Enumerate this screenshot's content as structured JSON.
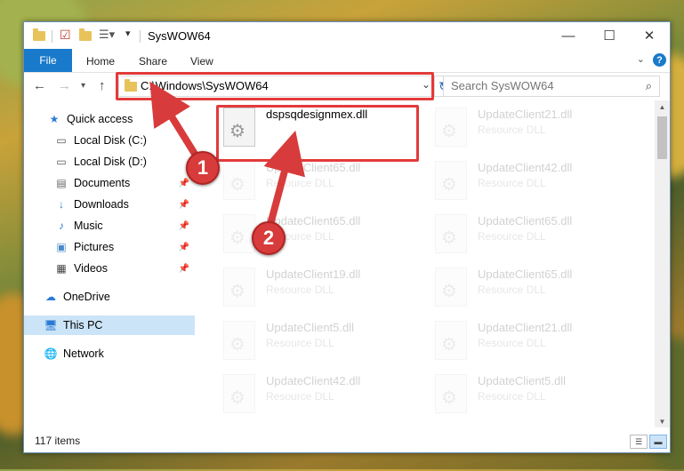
{
  "window": {
    "title": "SysWOW64",
    "minimize_icon": "minimize-icon",
    "maximize_icon": "maximize-icon",
    "close_icon": "close-icon"
  },
  "ribbon": {
    "file_tab": "File",
    "tabs": [
      "Home",
      "Share",
      "View"
    ],
    "help_label": "?"
  },
  "navigation": {
    "address": "C:\\Windows\\SysWOW64",
    "search_placeholder": "Search SysWOW64"
  },
  "sidebar": {
    "items": [
      {
        "label": "Quick access",
        "icon": "star-icon",
        "pinned": false
      },
      {
        "label": "Local Disk (C:)",
        "icon": "drive-icon",
        "pinned": false
      },
      {
        "label": "Local Disk (D:)",
        "icon": "drive-icon",
        "pinned": false
      },
      {
        "label": "Documents",
        "icon": "documents-icon",
        "pinned": true
      },
      {
        "label": "Downloads",
        "icon": "download-icon",
        "pinned": true
      },
      {
        "label": "Music",
        "icon": "music-icon",
        "pinned": true
      },
      {
        "label": "Pictures",
        "icon": "pictures-icon",
        "pinned": true
      },
      {
        "label": "Videos",
        "icon": "videos-icon",
        "pinned": true
      },
      {
        "label": "OneDrive",
        "icon": "cloud-icon",
        "pinned": false
      },
      {
        "label": "This PC",
        "icon": "computer-icon",
        "pinned": false,
        "selected": true
      },
      {
        "label": "Network",
        "icon": "network-icon",
        "pinned": false
      }
    ]
  },
  "files": [
    {
      "name": "dspsqdesignmex.dll",
      "type": "",
      "highlighted": true
    },
    {
      "name": "UpdateClient21.dll",
      "type": "Resource DLL"
    },
    {
      "name": "UpdateClient65.dll",
      "type": "Resource DLL"
    },
    {
      "name": "UpdateClient42.dll",
      "type": "Resource DLL"
    },
    {
      "name": "UpdateClient65.dll",
      "type": "Resource DLL"
    },
    {
      "name": "UpdateClient65.dll",
      "type": "Resource DLL"
    },
    {
      "name": "UpdateClient19.dll",
      "type": "Resource DLL"
    },
    {
      "name": "UpdateClient65.dll",
      "type": "Resource DLL"
    },
    {
      "name": "UpdateClient5.dll",
      "type": "Resource DLL"
    },
    {
      "name": "UpdateClient21.dll",
      "type": "Resource DLL"
    },
    {
      "name": "UpdateClient42.dll",
      "type": "Resource DLL"
    },
    {
      "name": "UpdateClient5.dll",
      "type": "Resource DLL"
    }
  ],
  "status": {
    "item_count": "117 items"
  },
  "annotations": {
    "callout_1": "1",
    "callout_2": "2",
    "color": "#d83b3b"
  },
  "colors": {
    "accent": "#1979ca",
    "selection": "#cce4f7",
    "highlight_border": "#e33a3a"
  }
}
